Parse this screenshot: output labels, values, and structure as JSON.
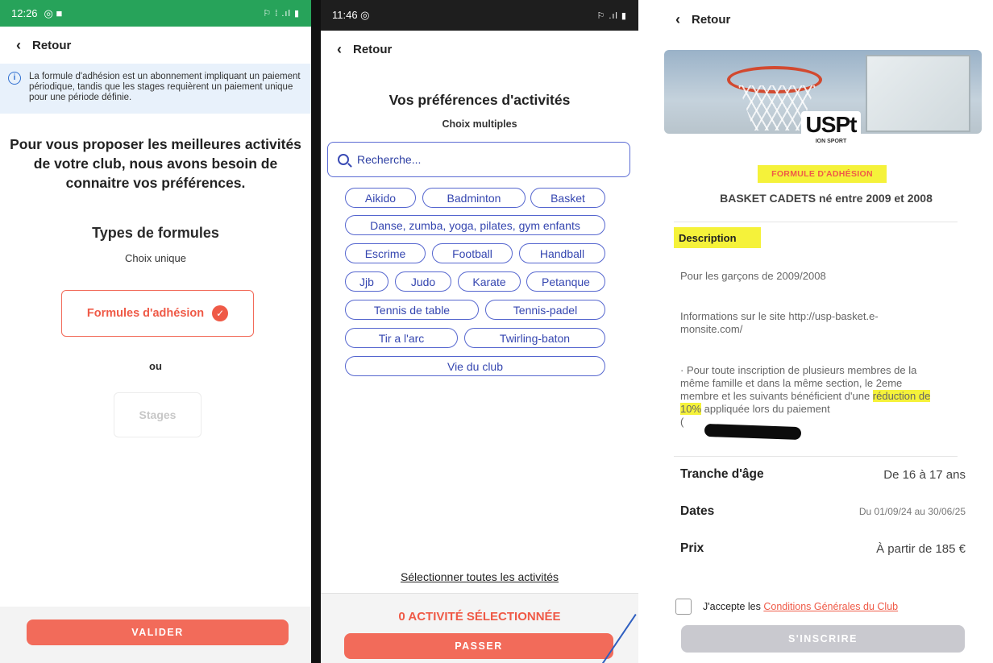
{
  "screen1": {
    "status_time": "12:26",
    "status_left_icons": "◎ ■",
    "status_right": "⚐ ⁞ .ıl ▮",
    "back_label": "Retour",
    "info_text": "La formule d'adhésion est un abonnement impliquant un paiement périodique, tandis que les stages requièrent un paiement unique pour une période définie.",
    "intro": "Pour vous proposer les meilleures activités de votre club, nous avons besoin de connaitre vos préférences.",
    "types_title": "Types de formules",
    "types_sub": "Choix unique",
    "option_adhesion": "Formules d'adhésion",
    "or_label": "ou",
    "option_stages": "Stages",
    "validate_label": "VALIDER"
  },
  "screen2": {
    "status_time": "11:46 ◎",
    "status_right": "⚐ .ıl ▮",
    "back_label": "Retour",
    "title": "Vos préférences d'activités",
    "subtitle": "Choix multiples",
    "search_placeholder": "Recherche...",
    "activities": [
      "Aikido",
      "Badminton",
      "Basket",
      "Danse, zumba, yoga, pilates, gym enfants",
      "Escrime",
      "Football",
      "Handball",
      "Jjb",
      "Judo",
      "Karate",
      "Petanque",
      "Tennis de table",
      "Tennis-padel",
      "Tir a l'arc",
      "Twirling-baton",
      "Vie du club"
    ],
    "select_all": "Sélectionner toutes les activités",
    "selected_count": "0 ACTIVITÉ SÉLECTIONNÉE",
    "skip_label": "PASSER"
  },
  "screen3": {
    "back_label": "Retour",
    "logo_text": "USPt",
    "logo_sub": "ION SPORT",
    "badge": "FORMULE D'ADHÉSION",
    "formula_title": "BASKET CADETS né entre 2009 et 2008",
    "description_label": "Description",
    "desc_1": "Pour les garçons de 2009/2008",
    "desc_2": "Informations sur le site http://usp-basket.e-monsite.com/",
    "desc_3a": "· Pour toute inscription de plusieurs membres de la même famille et dans la même section, le 2eme membre et les suivants bénéficient d'une ",
    "desc_3_highlight": "réduction de 10%",
    "desc_3b": " appliquée lors du paiement",
    "desc_3c": "(",
    "age_label": "Tranche d'âge",
    "age_value": "De 16 à 17 ans",
    "dates_label": "Dates",
    "dates_value": "Du 01/09/24 au 30/06/25",
    "price_label": "Prix",
    "price_value": "À partir de 185 €",
    "accept_prefix": "J'accepte les ",
    "accept_link": "Conditions Générales du Club",
    "register_label": "S'INSCRIRE"
  },
  "colors": {
    "accent": "#ef5a47",
    "chip_border": "#5566cf",
    "android_green": "#27a35a",
    "highlight": "#f5f23a"
  }
}
